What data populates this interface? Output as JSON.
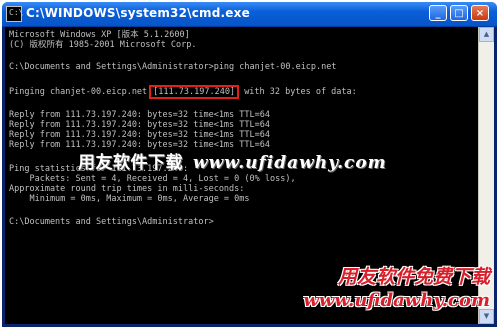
{
  "window": {
    "title": "C:\\WINDOWS\\system32\\cmd.exe",
    "icon_text": "C:\\",
    "buttons": {
      "minimize": "_",
      "maximize": "□",
      "close": "×"
    }
  },
  "console": {
    "lines": [
      "Microsoft Windows XP [版本 5.1.2600]",
      "(C) 版权所有 1985-2001 Microsoft Corp.",
      "",
      "C:\\Documents and Settings\\Administrator>ping chanjet-00.eicp.net",
      "",
      "",
      "",
      "Reply from 111.73.197.240: bytes=32 time<1ms TTL=64",
      "Reply from 111.73.197.240: bytes=32 time<1ms TTL=64",
      "Reply from 111.73.197.240: bytes=32 time<1ms TTL=64",
      "Reply from 111.73.197.240: bytes=32 time<1ms TTL=64",
      "",
      "Ping statistics for 111.73.197.240:",
      "    Packets: Sent = 4, Received = 4, Lost = 0 (0% loss),",
      "Approximate round trip times in milli-seconds:",
      "    Minimum = 0ms, Maximum = 0ms, Average = 0ms",
      "",
      "C:\\Documents and Settings\\Administrator>"
    ],
    "pinging": {
      "prefix": "Pinging chanjet-00.eicp.net",
      "ip": "[111.73.197.240]",
      "suffix": "with 32 bytes of data:"
    }
  },
  "watermarks": {
    "center_cn": "用友软件下载",
    "center_url": "www.ufidawhy.com",
    "corner_cn": "用友软件免费下载",
    "corner_url": "www.ufidawhy.com"
  },
  "colors": {
    "console_bg": "#000000",
    "console_text": "#c0c0c0",
    "highlight_box": "#e0201a",
    "watermark_red": "#d81f2a",
    "titlebar": "#0754c8"
  }
}
